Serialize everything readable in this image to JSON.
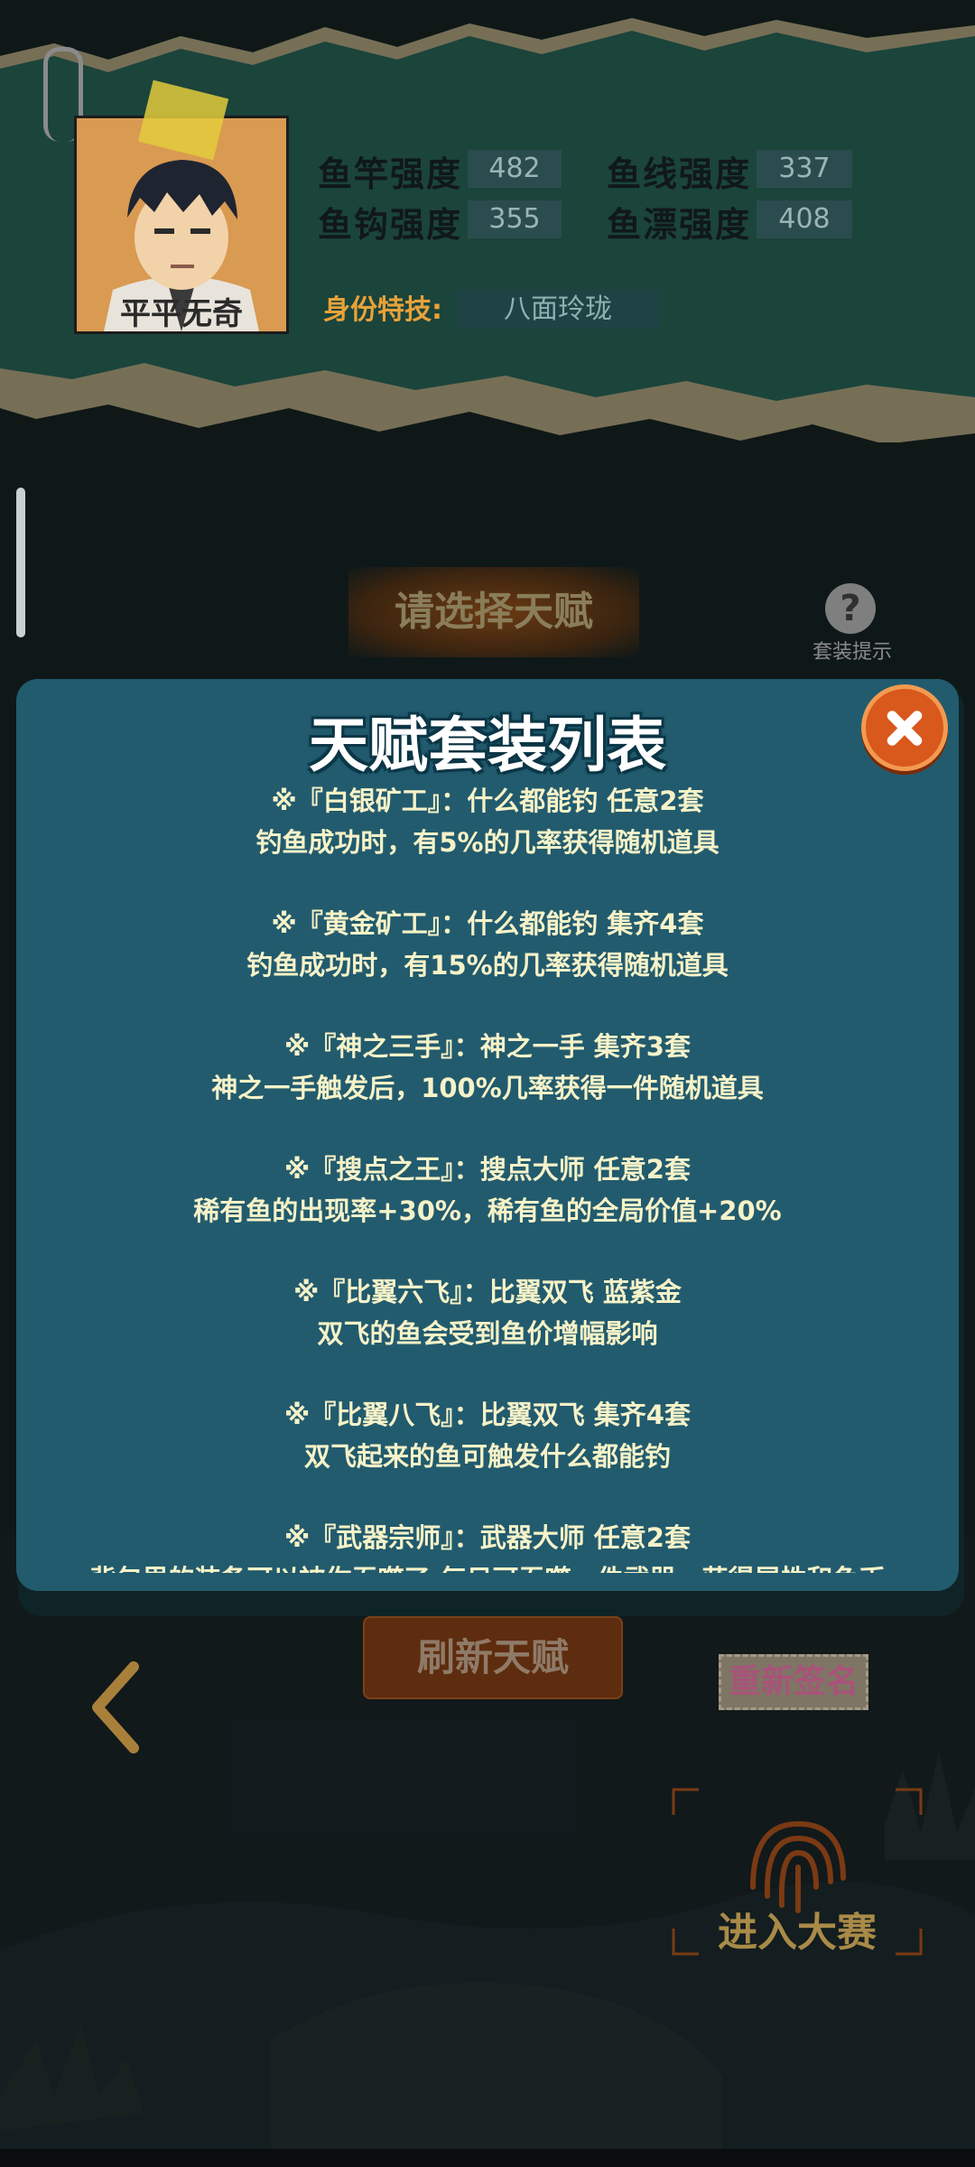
{
  "profile": {
    "name": "平平无奇",
    "stats": [
      {
        "label": "鱼竿强度",
        "value": "482"
      },
      {
        "label": "鱼线强度",
        "value": "337"
      },
      {
        "label": "鱼钩强度",
        "value": "355"
      },
      {
        "label": "鱼漂强度",
        "value": "408"
      }
    ],
    "skill_label": "身份特技:",
    "skill_value": "八面玲珑"
  },
  "choose_talent_label": "请选择天赋",
  "hint": {
    "icon": "question-icon",
    "glyph": "?",
    "label": "套装提示"
  },
  "modal": {
    "title": "天赋套装列表",
    "sets": [
      {
        "head": "※『白银矿工』：什么都能钓 任意2套",
        "desc": "钓鱼成功时，有5%的几率获得随机道具"
      },
      {
        "head": "※『黄金矿工』：什么都能钓 集齐4套",
        "desc": "钓鱼成功时，有15%的几率获得随机道具"
      },
      {
        "head": "※『神之三手』：神之一手 集齐3套",
        "desc": "神之一手触发后，100%几率获得一件随机道具"
      },
      {
        "head": "※『搜点之王』：搜点大师 任意2套",
        "desc": "稀有鱼的出现率+30%，稀有鱼的全局价值+20%"
      },
      {
        "head": "※『比翼六飞』：比翼双飞 蓝紫金",
        "desc": "双飞的鱼会受到鱼价增幅影响"
      },
      {
        "head": "※『比翼八飞』：比翼双飞 集齐4套",
        "desc": "双飞起来的鱼可触发什么都能钓"
      },
      {
        "head": "※『武器宗师』：武器大师 任意2套",
        "desc": "背包里的装备可以被你吞噬了,每日可吞噬一件武器，获得属性和鱼币"
      }
    ]
  },
  "bottom": {
    "refresh_label": "刷新天赋",
    "resign_label": "重新签名",
    "enter_label": "进入大赛"
  },
  "colors": {
    "modal_bg": "#225b6e",
    "modal_text": "#f6f2c8",
    "close_button": "#d9581c",
    "accent_orange": "#e7a23a"
  }
}
